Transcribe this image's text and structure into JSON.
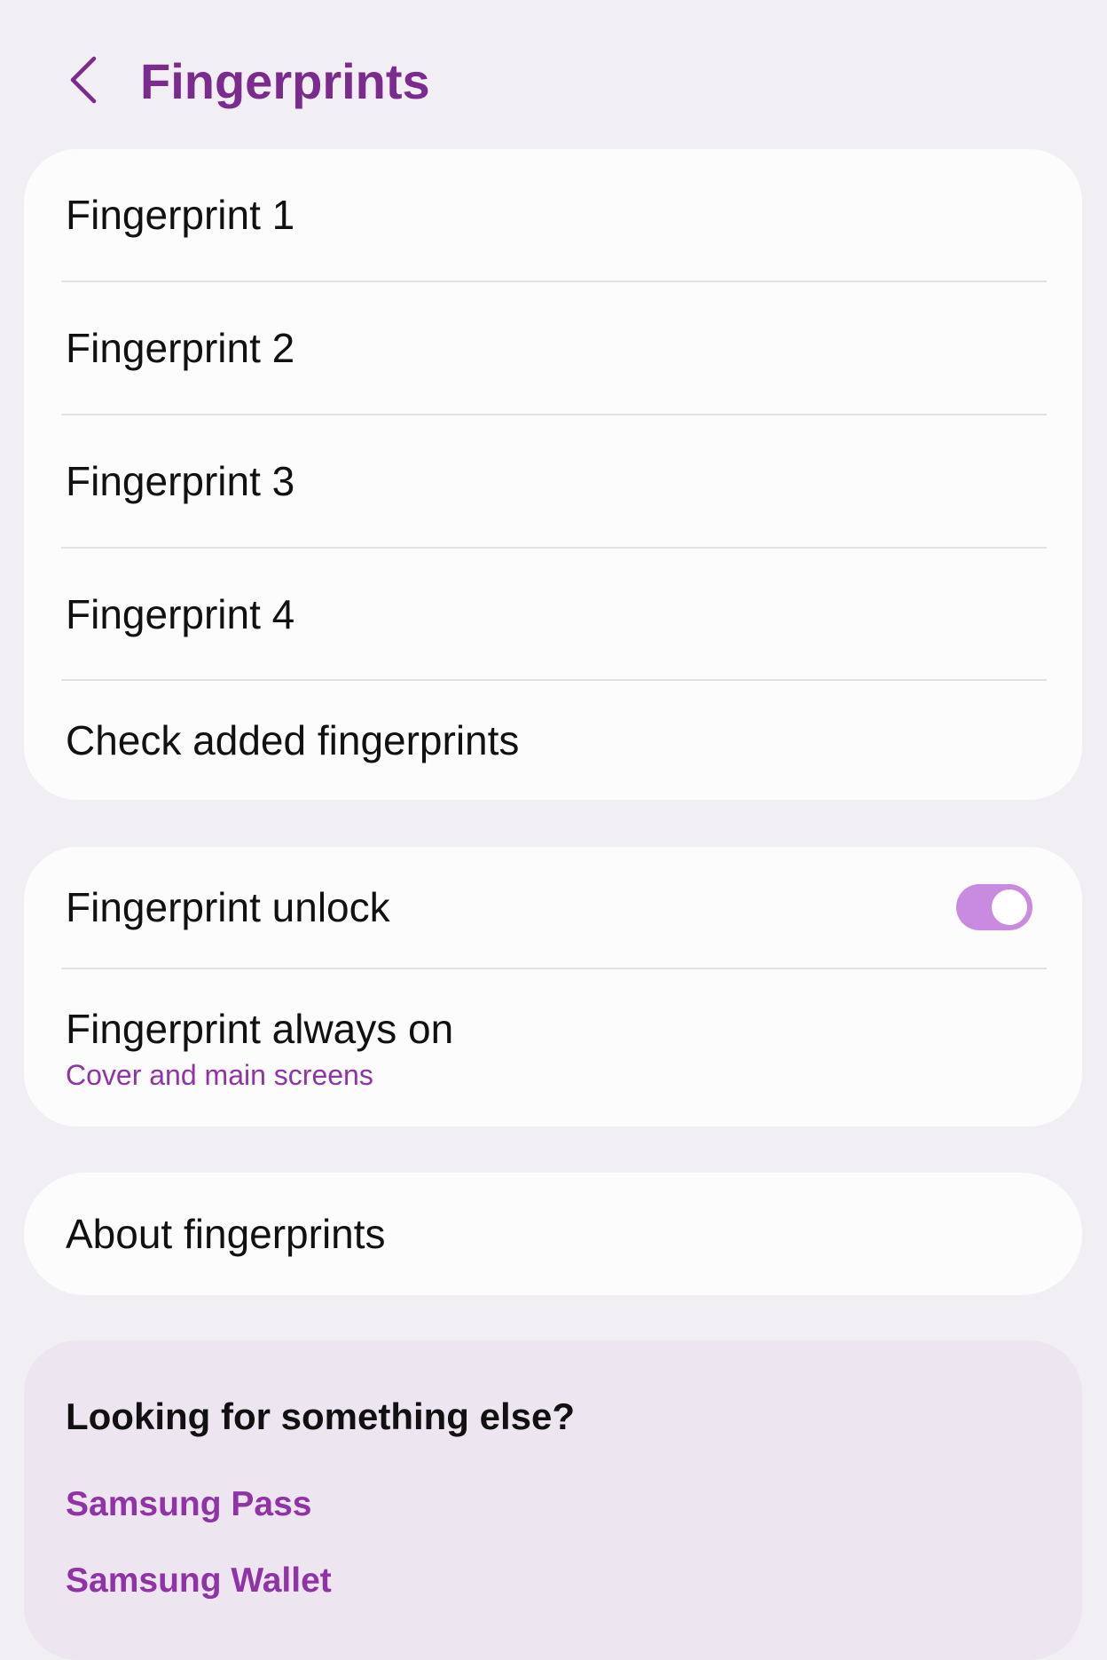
{
  "theme": {
    "accent": "#7b2a8e",
    "link": "#8f33a6",
    "toggle_on": "#c98be0",
    "card": "#fcfcfc",
    "background": "#f1eff4",
    "suggest_bg": "#ede5f0"
  },
  "header": {
    "back_icon": "chevron-left-icon",
    "title": "Fingerprints"
  },
  "fingerprints": {
    "items": [
      {
        "label": "Fingerprint 1"
      },
      {
        "label": "Fingerprint 2"
      },
      {
        "label": "Fingerprint 3"
      },
      {
        "label": "Fingerprint 4"
      }
    ],
    "check_label": "Check added fingerprints"
  },
  "settings": {
    "unlock_label": "Fingerprint unlock",
    "unlock_enabled": true,
    "always_on_label": "Fingerprint always on",
    "always_on_value": "Cover and main screens"
  },
  "about": {
    "label": "About fingerprints"
  },
  "suggestions": {
    "title": "Looking for something else?",
    "links": [
      {
        "label": "Samsung Pass"
      },
      {
        "label": "Samsung Wallet"
      }
    ]
  }
}
